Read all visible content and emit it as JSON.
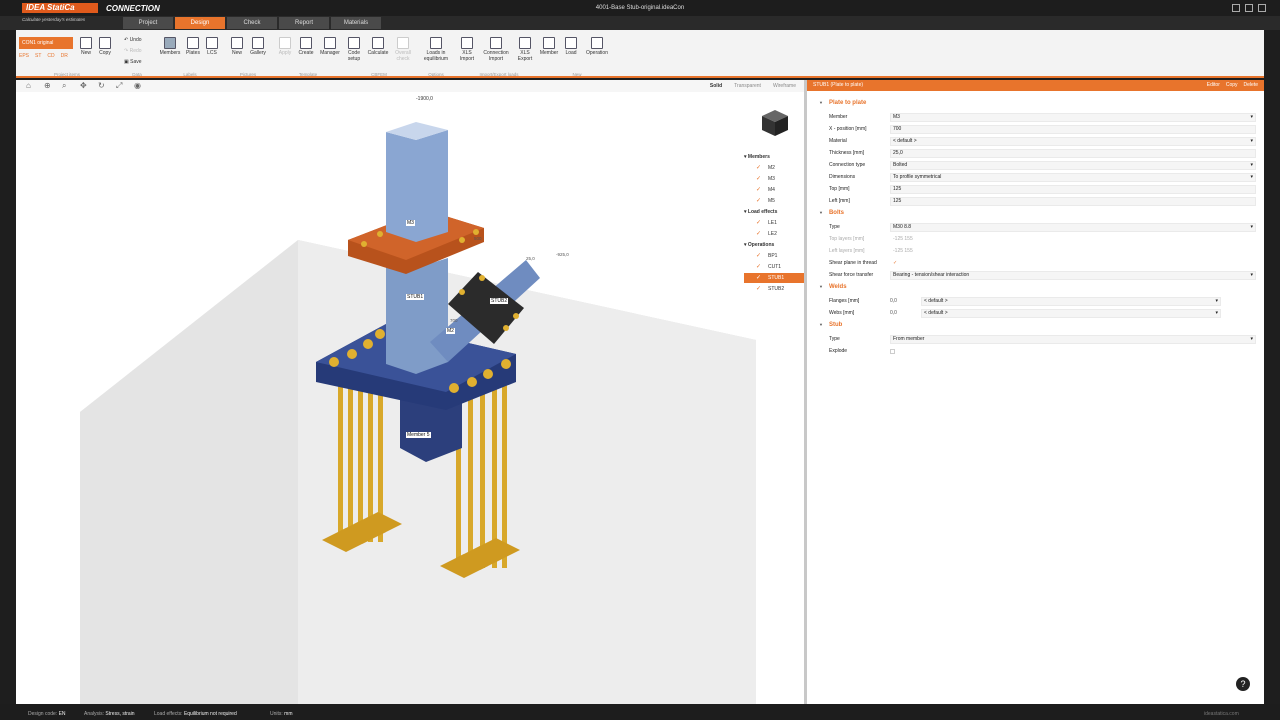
{
  "app": {
    "logo": "IDEA StatiCa",
    "tagline": "Calculate yesterday's estimates",
    "product": "CONNECTION",
    "window_title": "4001-Base Stub-original.ideaCon"
  },
  "tabs": [
    "Project",
    "Design",
    "Check",
    "Report",
    "Materials"
  ],
  "ribbon": {
    "cnt_label": "CON1 original",
    "small_buttons": [
      "EPS",
      "ST",
      "CD",
      "DR"
    ],
    "new_label": "New",
    "copy_label": "Copy",
    "undo": "Undo",
    "redo": "Redo",
    "save": "Save",
    "labels_group": [
      "Members",
      "Plates",
      "LCS"
    ],
    "pictures_group": [
      "New",
      "Gallery"
    ],
    "template_group": [
      "Apply",
      "Create",
      "Manager"
    ],
    "cbfem_group": [
      "Code setup",
      "Calculate",
      "Overall check"
    ],
    "options_group": [
      "Loads in equilibrium"
    ],
    "import_group": [
      "XLS Import",
      "Connection Import",
      "XLS Export"
    ],
    "new_group": [
      "Member",
      "Load",
      "Operation"
    ],
    "group_labels": {
      "project_items": "Project items",
      "data": "Data",
      "labels": "Labels",
      "pictures": "Pictures",
      "template": "Template",
      "cbfem": "CBFEM",
      "options": "Options",
      "import_export": "Import/Export loads",
      "new": "New"
    }
  },
  "viewport": {
    "modes": [
      "Solid",
      "Transparent",
      "Wireframe"
    ],
    "labels": {
      "top": "-1900,0",
      "m3": "M3",
      "stub1": "STUB1",
      "stub2": "STUB2",
      "m2": "M2",
      "member5": "Member 5",
      "dim500": "500",
      "dim700": "700",
      "dim925": "-925,0",
      "dim250": "25,0"
    }
  },
  "tree": {
    "members_header": "Members",
    "members": [
      "M2",
      "M3",
      "M4",
      "M5"
    ],
    "loads_header": "Load effects",
    "loads": [
      "LE1",
      "LE2"
    ],
    "ops_header": "Operations",
    "ops": [
      "BP1",
      "CUT1",
      "STUB1",
      "STUB2"
    ]
  },
  "props": {
    "header": "STUB1 (Plate to plate)",
    "actions": [
      "Editor",
      "Copy",
      "Delete"
    ],
    "sec_plate": "Plate to plate",
    "member_k": "Member",
    "member_v": "M3",
    "xpos_k": "X - position [mm]",
    "xpos_v": "700",
    "material_k": "Material",
    "material_v": "< default >",
    "thickness_k": "Thickness [mm]",
    "thickness_v": "25,0",
    "conntype_k": "Connection type",
    "conntype_v": "Bolted",
    "dims_k": "Dimensions",
    "dims_v": "To profile symmetrical",
    "top_k": "Top [mm]",
    "top_v": "125",
    "left_k": "Left [mm]",
    "left_v": "125",
    "sec_bolts": "Bolts",
    "type_k": "Type",
    "type_v": "M30 8.8",
    "toplayers_k": "Top layers [mm]",
    "toplayers_v": "-125 155",
    "leftlayers_k": "Left layers [mm]",
    "leftlayers_v": "-125 155",
    "shearplane_k": "Shear plane in thread",
    "shearplane_v": "✓",
    "shearforce_k": "Shear force transfer",
    "shearforce_v": "Bearing - tension/shear interaction",
    "sec_welds": "Welds",
    "flanges_k": "Flanges [mm]",
    "flanges_n": "0,0",
    "flanges_v": "< default >",
    "webs_k": "Webs [mm]",
    "webs_n": "0,0",
    "webs_v": "< default >",
    "sec_stub": "Stub",
    "stubtype_k": "Type",
    "stubtype_v": "From member",
    "explode_k": "Explode"
  },
  "status": {
    "code_k": "Design code:",
    "code_v": "EN",
    "analysis_k": "Analysis:",
    "analysis_v": "Stress, strain",
    "loads_k": "Load effects:",
    "loads_v": "Equilibrium not required",
    "units_k": "Units:",
    "units_v": "mm",
    "brand": "ideastatica.com"
  },
  "colors": {
    "accent": "#e8742c",
    "steel": "#7f9cc8",
    "plate_navy": "#263a78",
    "bolt_gold": "#d8a82a"
  }
}
